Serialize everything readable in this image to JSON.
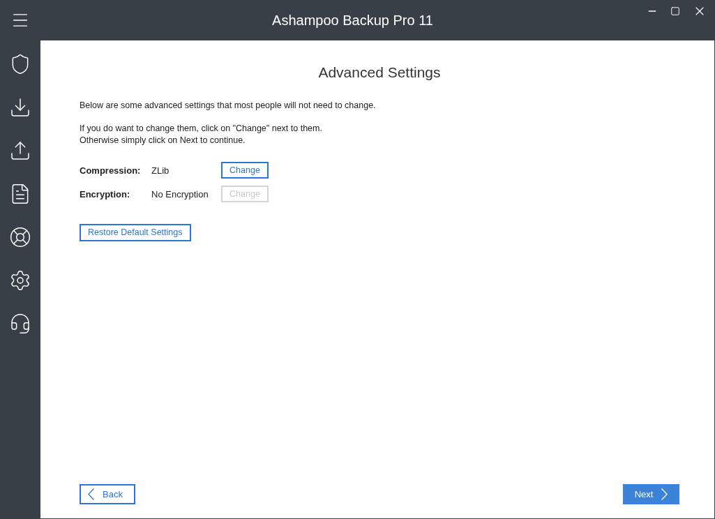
{
  "window": {
    "title": "Ashampoo Backup Pro 11"
  },
  "page": {
    "heading": "Advanced Settings",
    "intro": "Below are some advanced settings that most people will not need to change.",
    "hint": [
      "If you do want to change them, click on \"Change\" next to them.",
      "Otherwise simply click on Next to continue."
    ]
  },
  "settings": [
    {
      "label": "Compression:",
      "value": "ZLib",
      "button": "Change",
      "disabled": false
    },
    {
      "label": "Encryption:",
      "value": "No Encryption",
      "button": "Change",
      "disabled": true
    }
  ],
  "restore_button": "Restore Default Settings",
  "footer": {
    "back": "Back",
    "next": "Next"
  }
}
